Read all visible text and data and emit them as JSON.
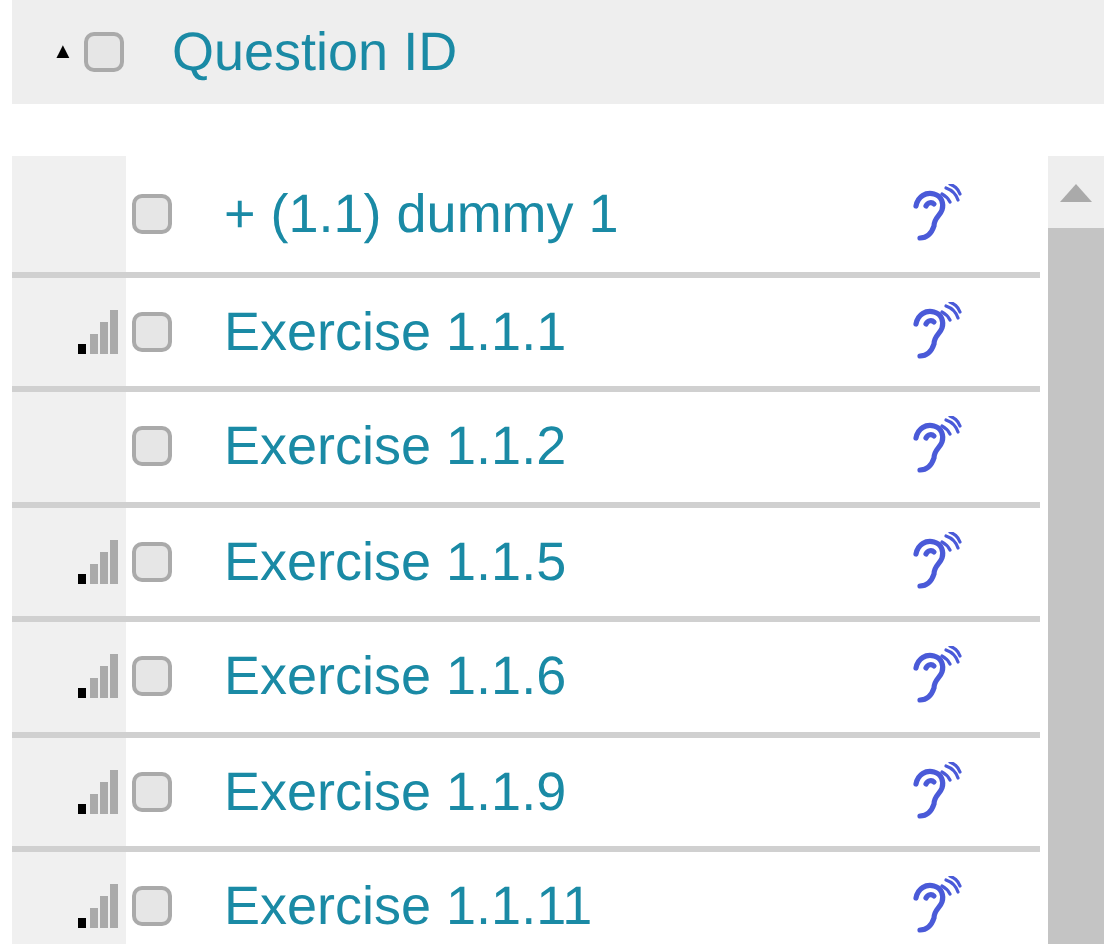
{
  "header": {
    "sort_arrow": "▲",
    "checked": false,
    "label": "Question ID"
  },
  "rows": [
    {
      "signal": false,
      "checked": false,
      "label": "+ (1.1) dummy 1"
    },
    {
      "signal": true,
      "checked": false,
      "label": "Exercise 1.1.1"
    },
    {
      "signal": false,
      "checked": false,
      "label": "Exercise 1.1.2"
    },
    {
      "signal": true,
      "checked": false,
      "label": "Exercise 1.1.5"
    },
    {
      "signal": true,
      "checked": false,
      "label": "Exercise 1.1.6"
    },
    {
      "signal": true,
      "checked": false,
      "label": "Exercise 1.1.9"
    },
    {
      "signal": true,
      "checked": false,
      "label": "Exercise 1.1.11"
    }
  ]
}
